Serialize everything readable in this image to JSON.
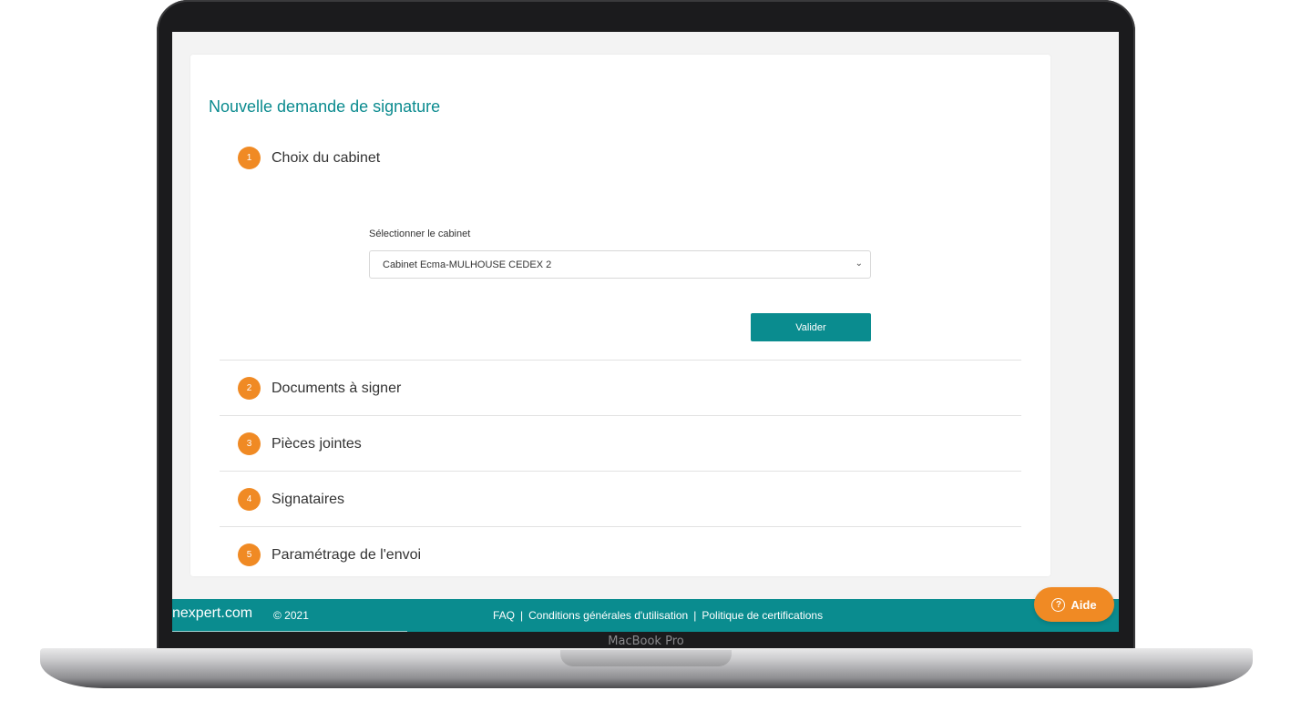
{
  "device": {
    "brand_label": "MacBook Pro"
  },
  "page": {
    "title": "Nouvelle demande de signature"
  },
  "steps": [
    {
      "number": "1",
      "title": "Choix du cabinet"
    },
    {
      "number": "2",
      "title": "Documents à signer"
    },
    {
      "number": "3",
      "title": "Pièces jointes"
    },
    {
      "number": "4",
      "title": "Signataires"
    },
    {
      "number": "5",
      "title": "Paramétrage de l'envoi"
    }
  ],
  "step1": {
    "field_label": "Sélectionner le cabinet",
    "selected_value": "Cabinet Ecma-MULHOUSE CEDEX 2",
    "validate_label": "Valider"
  },
  "footer": {
    "logo": "nexpert.com",
    "copyright": "© 2021",
    "links": [
      "FAQ",
      "Conditions générales d'utilisation",
      "Politique de certifications"
    ],
    "separator": "|"
  },
  "help": {
    "label": "Aide"
  },
  "colors": {
    "teal": "#0a8c8f",
    "orange": "#f08a24"
  }
}
